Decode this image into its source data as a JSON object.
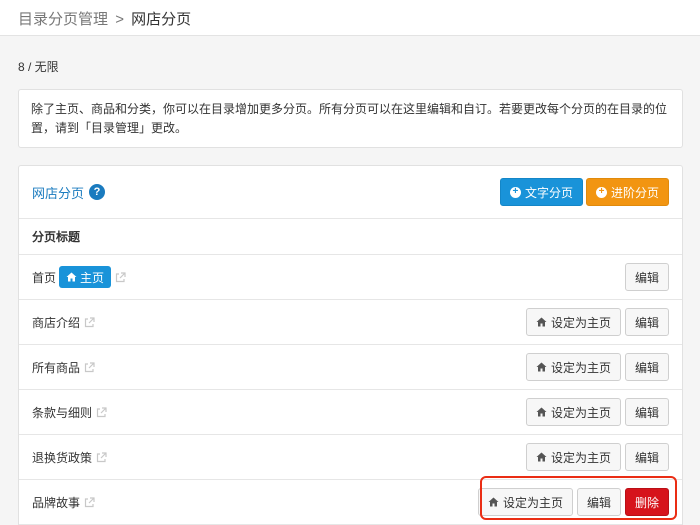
{
  "breadcrumb": {
    "parent": "目录分页管理",
    "separator": ">",
    "current": "网店分页"
  },
  "quota": "8 / 无限",
  "notice": "除了主页、商品和分类，你可以在目录增加更多分页。所有分页可以在这里编辑和自订。若要更改每个分页的在目录的位置，请到「目录管理」更改。",
  "panel": {
    "title": "网店分页",
    "help_icon": "?",
    "text_page_button": "文字分页",
    "advanced_page_button": "进阶分页",
    "column_header": "分页标题",
    "home_badge": "主页"
  },
  "actions": {
    "set_home": "设定为主页",
    "edit": "编辑",
    "delete": "删除"
  },
  "pages": [
    {
      "title": "首页",
      "is_home": true
    },
    {
      "title": "商店介绍",
      "is_home": false
    },
    {
      "title": "所有商品",
      "is_home": false
    },
    {
      "title": "条款与细则",
      "is_home": false
    },
    {
      "title": "退换货政策",
      "is_home": false
    },
    {
      "title": "品牌故事",
      "is_home": false,
      "deletable": true
    }
  ],
  "colors": {
    "primary": "#1993d9",
    "warning": "#f29511",
    "danger": "#d6131b",
    "highlight_frame": "#ea2d14"
  },
  "icons": [
    "help-icon",
    "plus-circle-icon",
    "home-icon",
    "external-link-icon"
  ]
}
